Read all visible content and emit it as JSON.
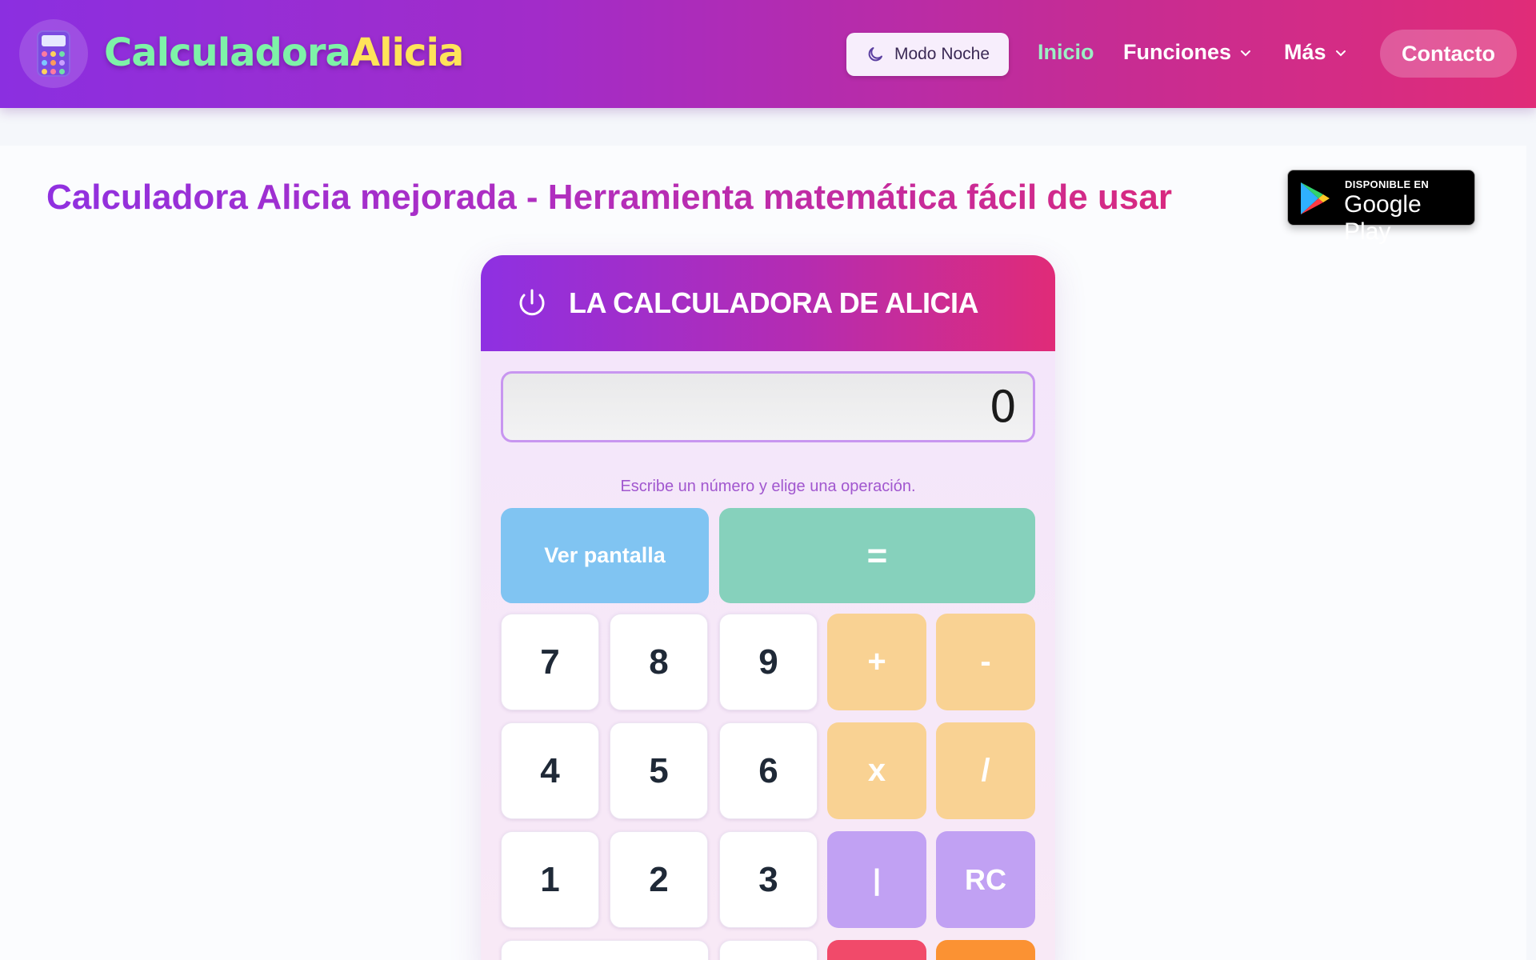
{
  "navbar": {
    "brand_part1": "Calculadora",
    "brand_part2": "Alicia",
    "night_mode_label": "Modo Noche",
    "links": [
      {
        "label": "Inicio",
        "active": true
      },
      {
        "label": "Funciones",
        "dropdown": true
      },
      {
        "label": "Más",
        "dropdown": true
      }
    ],
    "contact_label": "Contacto"
  },
  "main": {
    "title": "Calculadora Alicia mejorada - Herramienta matemática fácil de usar",
    "gplay_small": "DISPONIBLE EN",
    "gplay_big": "Google Play"
  },
  "calculator": {
    "header_title": "LA CALCULADORA DE ALICIA",
    "display_value": "0",
    "hint": "Escribe un número y elige una operación.",
    "keys": {
      "view_screen": "Ver pantalla",
      "equals": "=",
      "k7": "7",
      "k8": "8",
      "k9": "9",
      "plus": "+",
      "minus": "-",
      "k4": "4",
      "k5": "5",
      "k6": "6",
      "times": "x",
      "divide": "/",
      "k1": "1",
      "k2": "2",
      "k3": "3",
      "bar": "|",
      "rc": "RC"
    }
  },
  "colors": {
    "nav_gradient_start": "#8b2fe0",
    "nav_gradient_end": "#e02c78",
    "brand_green": "#7ef2a8",
    "brand_yellow": "#ffe35a",
    "active_link": "#9cf0c4",
    "key_blue": "#80c4f2",
    "key_green": "#86d1bc",
    "key_orange": "#f9d293",
    "key_purple": "#c1a1f3"
  },
  "icons": {
    "logo": "calculator-icon",
    "night": "moon-icon",
    "dropdown": "chevron-down-icon",
    "power": "power-icon",
    "store": "google-play-icon"
  }
}
